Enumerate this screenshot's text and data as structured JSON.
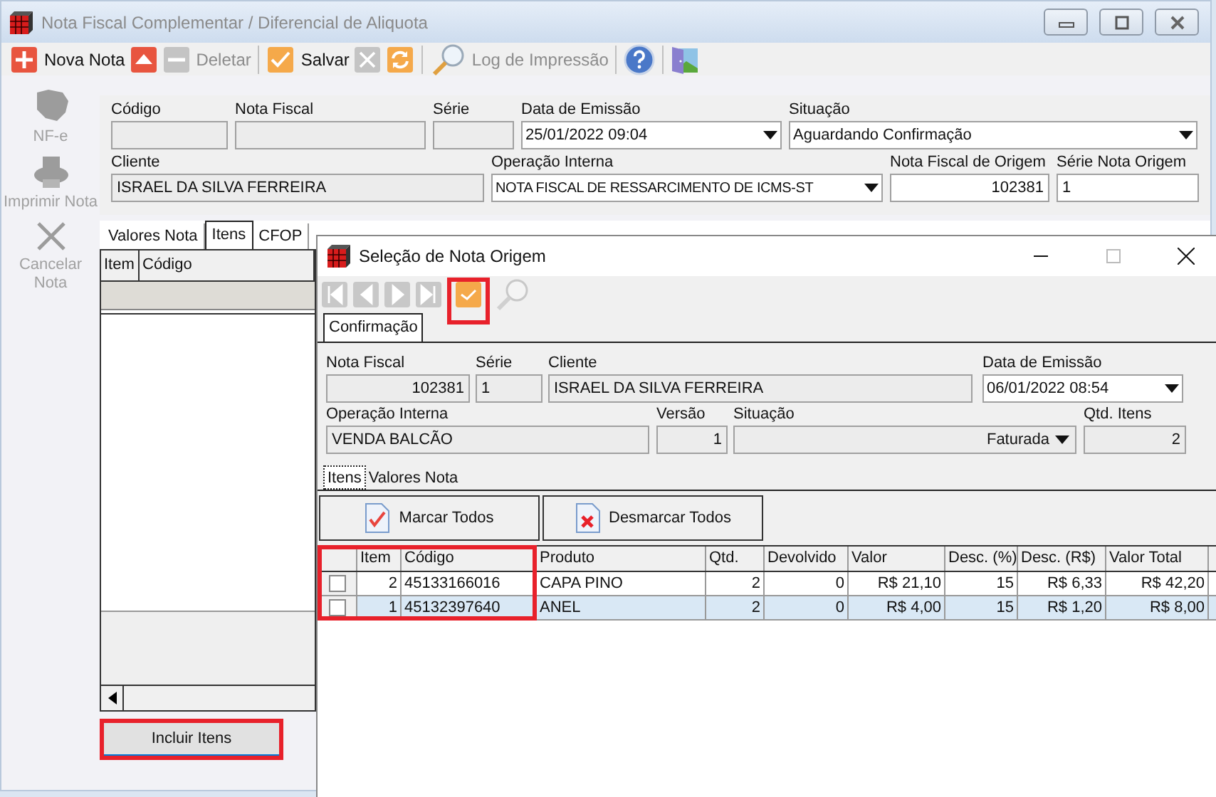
{
  "window": {
    "title": "Nota Fiscal Complementar / Diferencial de Aliquota"
  },
  "toolbar": [
    {
      "kind": "new",
      "label": "Nova Nota",
      "disabled": false
    },
    {
      "kind": "up"
    },
    {
      "kind": "delete",
      "label": "Deletar",
      "disabled": true
    },
    {
      "kind": "separator"
    },
    {
      "kind": "save",
      "label": "Salvar",
      "disabled": false
    },
    {
      "kind": "cancel",
      "disabled": true
    },
    {
      "kind": "refresh"
    },
    {
      "kind": "separator"
    },
    {
      "kind": "search",
      "disabled": false
    },
    {
      "kind": "log",
      "label": "Log de Impressão",
      "disabled": true
    },
    {
      "kind": "separator"
    },
    {
      "kind": "help"
    },
    {
      "kind": "separator"
    },
    {
      "kind": "exit"
    }
  ],
  "sidebar": {
    "items": [
      {
        "kind": "nfe",
        "label": "NF-e",
        "disabled": true
      },
      {
        "kind": "print",
        "label": "Imprimir Nota",
        "disabled": true
      },
      {
        "kind": "cancel",
        "label": "Cancelar Nota",
        "disabled": true
      }
    ]
  },
  "form": {
    "fields": [
      {
        "label": "Código",
        "kind": "text",
        "readonly": true
      },
      {
        "label": "Nota Fiscal",
        "kind": "text",
        "readonly": true
      },
      {
        "label": "Série",
        "kind": "text",
        "readonly": true
      },
      {
        "label": "Data de Emissão",
        "kind": "dropdown",
        "value": "25/01/2022 09:04",
        "readonly": false
      },
      {
        "label": "Situação",
        "kind": "dropdown",
        "value": "Aguardando Confirmação",
        "readonly": false
      },
      {
        "label": "Cliente",
        "kind": "text",
        "value": "ISRAEL DA SILVA FERREIRA",
        "readonly": true
      },
      {
        "label": "Operação Interna",
        "kind": "dropdown",
        "value": "NOTA FISCAL DE RESSARCIMENTO DE ICMS-ST",
        "readonly": false
      },
      {
        "label": "Nota Fiscal de Origem",
        "kind": "number",
        "value": "102381",
        "readonly": false
      },
      {
        "label": "Série Nota Origem",
        "kind": "text",
        "value": "1",
        "readonly": false
      }
    ]
  },
  "tabs": [
    {
      "label": "Valores Nota",
      "selected": false
    },
    {
      "label": "Itens",
      "selected": true
    },
    {
      "label": "CFOP",
      "selected": false
    }
  ],
  "items_table": {
    "columns": [
      "Item",
      "Código"
    ]
  },
  "include_button": {
    "label": "Incluir Itens",
    "highlighted": true
  },
  "dialog": {
    "title": "Seleção de Nota Origem",
    "toolbar": [
      {
        "kind": "first",
        "disabled": true
      },
      {
        "kind": "prev",
        "disabled": true
      },
      {
        "kind": "next",
        "disabled": true
      },
      {
        "kind": "last",
        "disabled": true
      },
      {
        "kind": "confirm",
        "highlighted": true
      },
      {
        "kind": "search",
        "disabled": true
      }
    ],
    "tabs": [
      {
        "label": "Confirmação",
        "selected": true
      }
    ],
    "form": {
      "fields": [
        {
          "label": "Nota Fiscal",
          "kind": "number",
          "value": "102381",
          "readonly": true
        },
        {
          "label": "Série",
          "kind": "text",
          "value": "1",
          "readonly": true
        },
        {
          "label": "Cliente",
          "kind": "text",
          "value": "ISRAEL DA SILVA FERREIRA",
          "readonly": true
        },
        {
          "label": "Data de Emissão",
          "kind": "dropdown",
          "value": "06/01/2022 08:54",
          "readonly": false
        },
        {
          "label": "Operação Interna",
          "kind": "text",
          "value": "VENDA BALCÃO",
          "readonly": true
        },
        {
          "label": "Versão",
          "kind": "number",
          "value": "1",
          "readonly": true
        },
        {
          "label": "Situação",
          "kind": "dropdown-right",
          "value": "Faturada",
          "readonly": true
        },
        {
          "label": "Qtd. Itens",
          "kind": "number",
          "value": "2",
          "readonly": true
        }
      ]
    },
    "inner_tabs": [
      {
        "label": "Itens",
        "selected": true
      },
      {
        "label": "Valores Nota",
        "selected": false
      }
    ],
    "buttons": [
      {
        "kind": "mark",
        "label": "Marcar Todos"
      },
      {
        "kind": "unmark",
        "label": "Desmarcar Todos"
      }
    ],
    "table": {
      "columns": [
        {
          "kind": "number",
          "label": "Item",
          "highlighted": true
        },
        {
          "kind": "text",
          "label": "Código",
          "highlighted": true
        },
        {
          "kind": "text",
          "label": "Produto",
          "highlighted": false
        },
        {
          "kind": "number",
          "label": "Qtd.",
          "highlighted": false
        },
        {
          "kind": "number",
          "label": "Devolvido",
          "highlighted": false
        },
        {
          "kind": "number",
          "label": "Valor",
          "highlighted": false
        },
        {
          "kind": "number",
          "label": "Desc. (%)",
          "highlighted": false
        },
        {
          "kind": "number",
          "label": "Desc. (R$)",
          "highlighted": false
        },
        {
          "kind": "number",
          "label": "Valor Total",
          "highlighted": false
        }
      ],
      "rows": [
        {
          "checked": false,
          "selected": false,
          "cells": [
            "2",
            "45133166016",
            "CAPA PINO",
            "2",
            "0",
            "R$ 21,10",
            "15",
            "R$ 6,33",
            "R$ 42,20"
          ]
        },
        {
          "checked": false,
          "selected": true,
          "cells": [
            "1",
            "45132397640",
            "ANEL",
            "2",
            "0",
            "R$ 4,00",
            "15",
            "R$ 1,20",
            "R$ 8,00"
          ]
        }
      ]
    }
  }
}
